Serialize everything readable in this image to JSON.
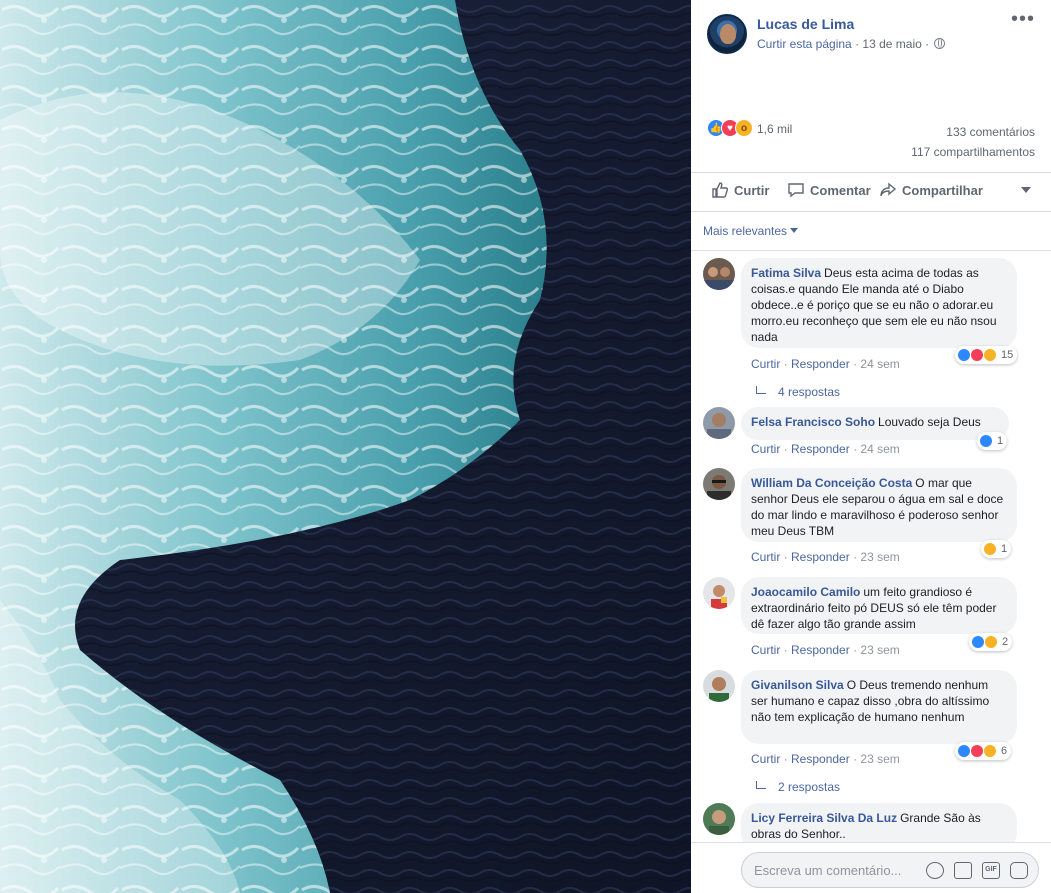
{
  "post": {
    "page_name": "Lucas de Lima",
    "like_page": "Curtir esta página",
    "date": "13 de maio",
    "separator": "·",
    "more_icon": "more-dots-icon",
    "privacy_icon": "globe-icon"
  },
  "reactions": {
    "icons": [
      "like-icon",
      "love-icon",
      "wow-icon"
    ],
    "count": "1,6 mil",
    "comments": "133 comentários",
    "shares": "117 compartilhamentos"
  },
  "actions": {
    "like": "Curtir",
    "comment": "Comentar",
    "share": "Compartilhar"
  },
  "sort_label": "Mais relevantes",
  "comment_link_like": "Curtir",
  "comment_link_reply": "Responder",
  "comments": [
    {
      "author": "Fatima Silva",
      "text": "Deus esta acima de todas as coisas.e quando Ele manda até o Diabo obdece..e é poriço que se eu não o adorar.eu morro.eu reconheço que sem ele eu não nsou nada",
      "time": "24 sem",
      "reaction_count": "15",
      "reactions": [
        "like",
        "love",
        "haha"
      ],
      "replies": "4 respostas"
    },
    {
      "author": "Felsa Francisco Soho",
      "text": "Louvado seja Deus",
      "time": "24 sem",
      "reaction_count": "1",
      "reactions": [
        "like"
      ],
      "replies": ""
    },
    {
      "author": "William Da Conceição Costa",
      "text": "O mar que senhor Deus ele separou o água em sal e doce do mar lindo e maravilhoso é poderoso senhor meu Deus TBM",
      "time": "23 sem",
      "reaction_count": "1",
      "reactions": [
        "haha"
      ],
      "replies": ""
    },
    {
      "author": "Joaocamilo Camilo",
      "text": "um feito grandioso é extraordinário feito pó DEUS só ele têm poder dê fazer algo tão grande assim",
      "time": "23 sem",
      "reaction_count": "2",
      "reactions": [
        "like",
        "haha"
      ],
      "replies": ""
    },
    {
      "author": "Givanilson Silva",
      "text": "O Deus tremendo nenhum ser humano e capaz disso ,obra do altíssimo não tem explicação de humano nenhum",
      "time": "23 sem",
      "reaction_count": "6",
      "reactions": [
        "like",
        "love",
        "haha"
      ],
      "replies": "2 respostas"
    },
    {
      "author": "Licy Ferreira Silva Da Luz",
      "text": "Grande São às obras do Senhor..",
      "time": "",
      "reaction_count": "",
      "reactions": [],
      "replies": ""
    }
  ],
  "composer": {
    "placeholder": "Escreva um comentário...",
    "gif_label": "GIF",
    "tools": [
      "emoji-icon",
      "camera-icon",
      "gif-icon",
      "sticker-icon"
    ]
  },
  "colors": {
    "link": "#385898",
    "secondary_link": "#4b67a1",
    "muted": "#90949c",
    "bubble": "#f2f3f5",
    "like": "#2d88ff",
    "love": "#f33e58",
    "haha": "#f7b125"
  }
}
